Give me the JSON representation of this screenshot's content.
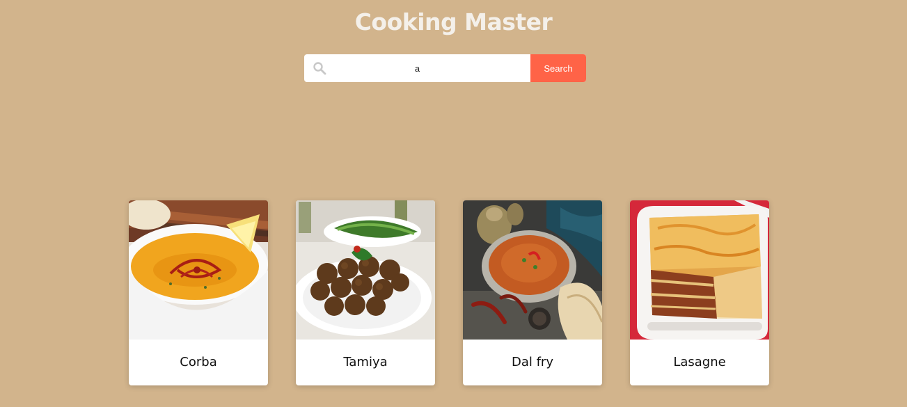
{
  "header": {
    "title": "Cooking Master"
  },
  "search": {
    "value": "a",
    "button_label": "Search",
    "icon": "search-icon"
  },
  "meals": [
    {
      "name": "Corba",
      "image": "soup-bowl-image"
    },
    {
      "name": "Tamiya",
      "image": "falafel-plate-image"
    },
    {
      "name": "Dal fry",
      "image": "curry-bowl-image"
    },
    {
      "name": "Lasagne",
      "image": "lasagne-dish-image"
    }
  ],
  "colors": {
    "background": "#d2b48c",
    "accent": "#ff6347",
    "card": "#ffffff"
  }
}
